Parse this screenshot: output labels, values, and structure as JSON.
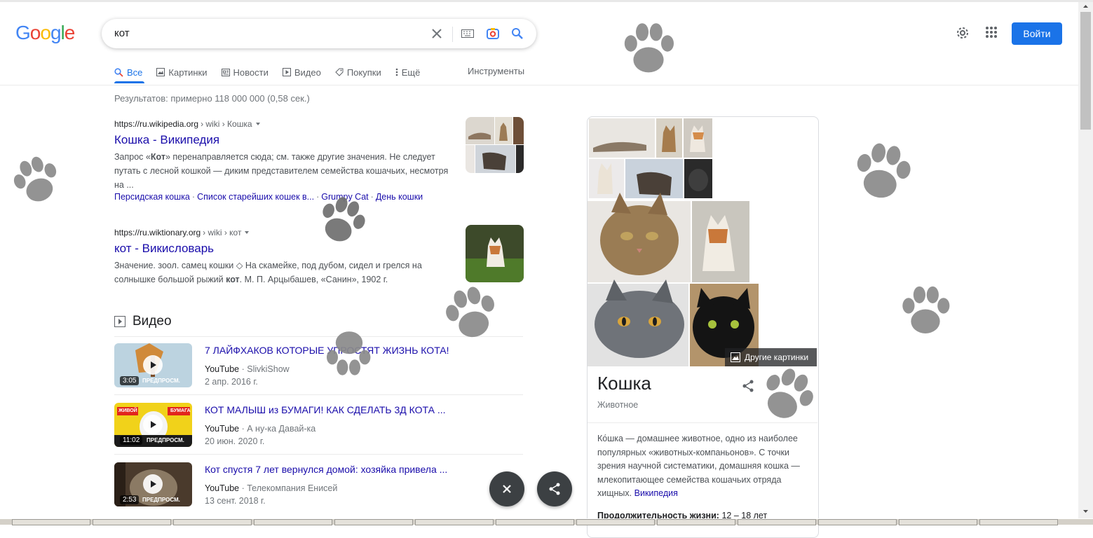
{
  "logo": {
    "text": "Google"
  },
  "search": {
    "query": "кот"
  },
  "header": {
    "signin_label": "Войти"
  },
  "tabs": [
    {
      "label": "Все",
      "icon": "search-icon",
      "active": true
    },
    {
      "label": "Картинки",
      "icon": "image-icon"
    },
    {
      "label": "Новости",
      "icon": "news-icon"
    },
    {
      "label": "Видео",
      "icon": "video-icon"
    },
    {
      "label": "Покупки",
      "icon": "tag-icon"
    },
    {
      "label": "Ещё",
      "icon": "more-vert-icon"
    }
  ],
  "tools_label": "Инструменты",
  "stats": "Результатов: примерно 118 000 000 (0,58 сек.)",
  "results": [
    {
      "cite_domain": "https://ru.wikipedia.org",
      "cite_path": " › wiki › Кошка",
      "title": "Кошка - Википедия",
      "snippet_pre": "Запрос «",
      "snippet_bold": "Кот",
      "snippet_post": "» перенаправляется сюда; см. также другие значения. Не следует путать с лесной кошкой — диким представителем семейства кошачьих, несмотря на ...",
      "sitelinks": [
        "Персидская кошка",
        "Список старейших кошек в...",
        "Grumpy Cat",
        "День кошки"
      ]
    },
    {
      "cite_domain": "https://ru.wiktionary.org",
      "cite_path": " › wiki › кот",
      "title": "кот - Викисловарь",
      "snippet_pre": "Значение. зоол. самец кошки ◇ На скамейке, под дубом, сидел и грелся на солнышке большой рыжий ",
      "snippet_bold": "кот",
      "snippet_post": ". М. П. Арцыбашев, «Санин», 1902 г."
    }
  ],
  "videos_header": "Видео",
  "videos": [
    {
      "title": "7 ЛАЙФХАКОВ КОТОРЫЕ УПРОСТЯТ ЖИЗНЬ КОТА!",
      "source": "YouTube",
      "channel": "SlivkiShow",
      "date": "2 апр. 2016 г.",
      "duration": "3:05",
      "preview": "ПРЕДПРОСМ."
    },
    {
      "title": "КОТ МАЛЫШ из БУМАГИ! КАК СДЕЛАТЬ 3Д КОТА ...",
      "source": "YouTube",
      "channel": "А ну-ка Давай-ка",
      "date": "20 июн. 2020 г.",
      "duration": "11:02",
      "preview": "ПРЕДПРОСМ.",
      "thumb_labels": [
        "ЖИВОЙ",
        "БУМАГА"
      ]
    },
    {
      "title": "Кот спустя 7 лет вернулся домой: хозяйка привела ...",
      "source": "YouTube",
      "channel": "Телекомпания Енисей",
      "date": "13 сент. 2018 г.",
      "duration": "2:53",
      "preview": "ПРЕДПРОСМ."
    }
  ],
  "knowledge_panel": {
    "more_images_label": "Другие картинки",
    "title": "Кошка",
    "subtitle": "Животное",
    "description": "Ко́шка — домашнее животное, одно из наиболее популярных «животных-компаньонов». С точки зрения научной систематики, домашняя кошка — млекопитающее семейства кошачьих отряда хищных.",
    "source_link": "Википедия",
    "life_label": "Продолжительность жизни:",
    "life_value": "12 – 18 лет"
  },
  "colors": {
    "accent": "#1a73e8",
    "link": "#1a0dab",
    "paw": "#8a8a8a"
  }
}
